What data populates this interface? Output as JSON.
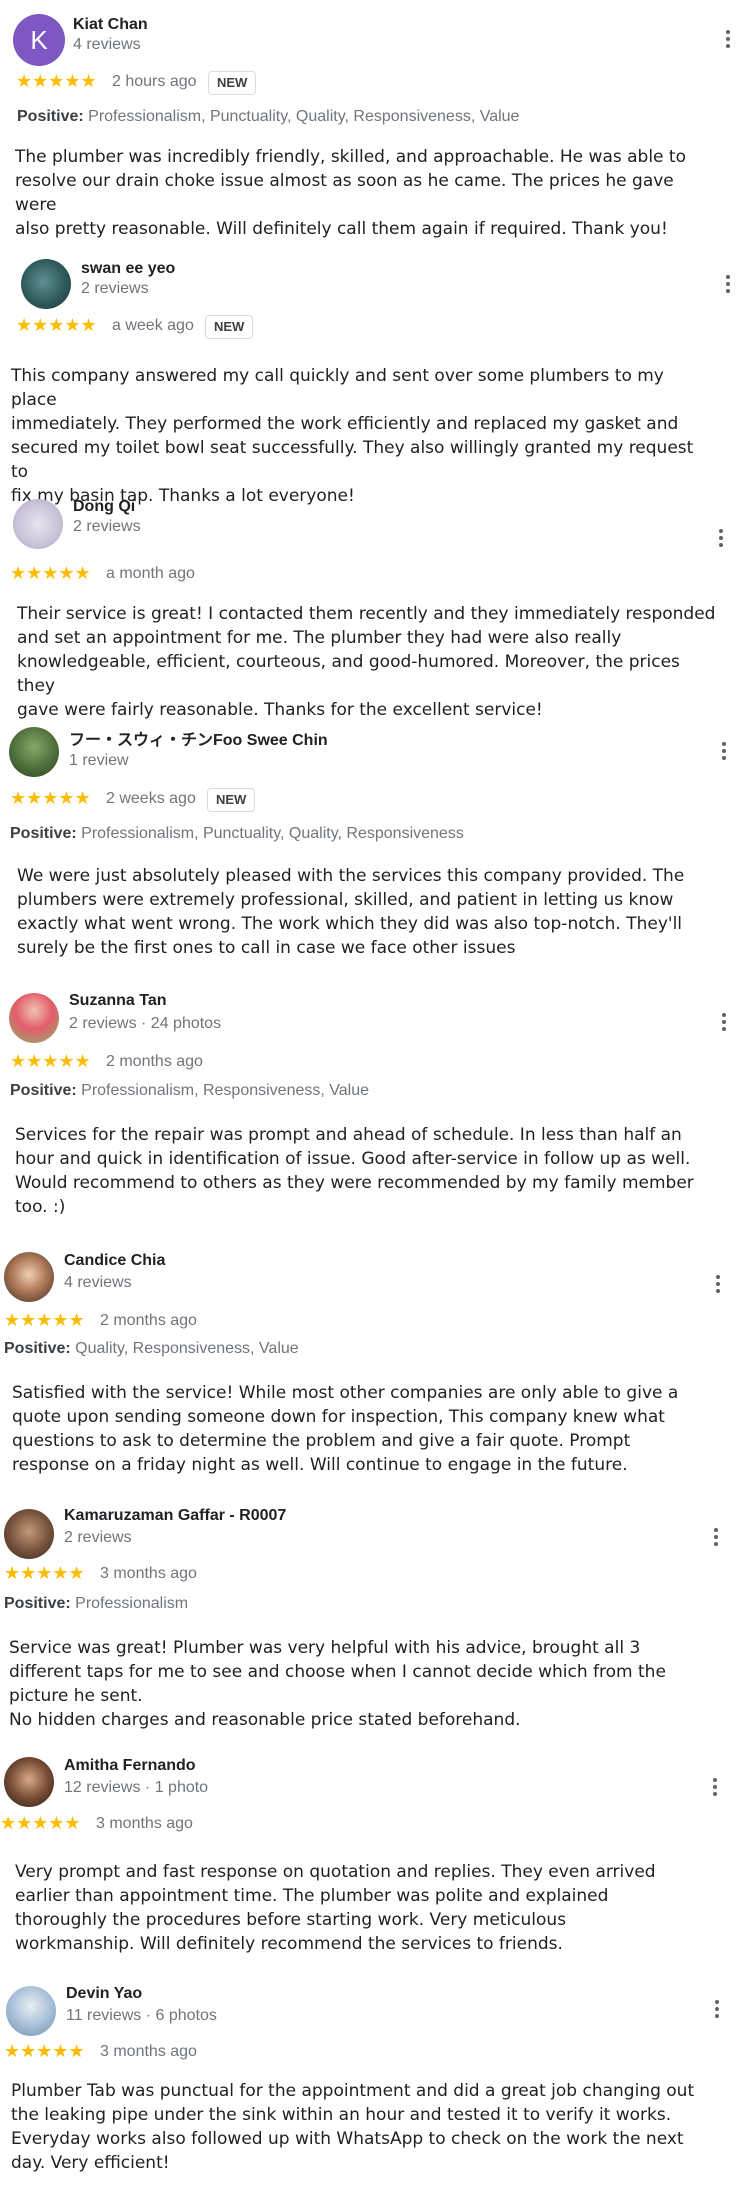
{
  "reviews": [
    {
      "name": "Kiat Chan",
      "meta": "4 reviews",
      "avatar_letter": "K",
      "stars": "★★★★★",
      "time": "2 hours ago",
      "badge": "NEW",
      "positive_label": "Positive:",
      "positive": "Professionalism, Punctuality, Quality, Responsiveness, Value",
      "text": "The plumber was incredibly friendly, skilled, and approachable. He was able to\nresolve our drain choke issue almost as soon as he came. The prices he gave were\nalso pretty reasonable. Will definitely call them again if required. Thank you!"
    },
    {
      "name": "swan ee yeo",
      "meta": "2 reviews",
      "stars": "★★★★★",
      "time": "a week ago",
      "badge": "NEW",
      "text": "This company answered my call quickly and sent over some plumbers to my place\nimmediately. They performed the work efficiently and replaced my gasket and\nsecured my toilet bowl seat successfully. They also willingly granted my request to\nfix my basin tap. Thanks a lot everyone!"
    },
    {
      "name": "Dong Qi",
      "meta": "2 reviews",
      "stars": "★★★★★",
      "time": "a month ago",
      "text": "Their service is great! I contacted them recently and they immediately responded\nand set an appointment for me. The plumber they had were also really\nknowledgeable, efficient, courteous, and good-humored. Moreover, the prices they\ngave were fairly reasonable. Thanks for the excellent service!"
    },
    {
      "name": "フー・スウィ・チンFoo Swee Chin",
      "meta": "1 review",
      "stars": "★★★★★",
      "time": "2 weeks ago",
      "badge": "NEW",
      "positive_label": "Positive:",
      "positive": "Professionalism, Punctuality, Quality, Responsiveness",
      "text": "We were just absolutely pleased with the services this company provided. The\nplumbers were extremely professional, skilled, and patient in letting us know\nexactly what went wrong. The work which they did was also top-notch. They'll\nsurely be the first ones to call in case we face other issues"
    },
    {
      "name": "Suzanna Tan",
      "meta": "2 reviews · 24 photos",
      "stars": "★★★★★",
      "time": "2 months ago",
      "positive_label": "Positive:",
      "positive": "Professionalism, Responsiveness, Value",
      "text": "Services for the repair was prompt and ahead of schedule. In less than half an\nhour and quick in identification of issue. Good after-service in follow up as well.\nWould recommend to others as they were recommended by my family member\ntoo. :)"
    },
    {
      "name": "Candice Chia",
      "meta": "4 reviews",
      "stars": "★★★★★",
      "time": "2 months ago",
      "positive_label": "Positive:",
      "positive": "Quality, Responsiveness, Value",
      "text": "Satisfied with the service! While most other companies are only able to give a\nquote upon sending someone down for inspection, This company knew what\nquestions to ask to determine the problem and give a fair quote. Prompt\nresponse on a friday night as well. Will continue to engage in the future."
    },
    {
      "name": "Kamaruzaman Gaffar - R0007",
      "meta": "2 reviews",
      "stars": "★★★★★",
      "time": "3 months ago",
      "positive_label": "Positive:",
      "positive": "Professionalism",
      "text": "Service was great! Plumber was very helpful with his advice, brought all 3\ndifferent taps for me to see and choose when I cannot decide which from the\npicture he sent.\nNo hidden charges and reasonable price stated beforehand."
    },
    {
      "name": "Amitha Fernando",
      "meta": "12 reviews · 1 photo",
      "stars": "★★★★★",
      "time": "3 months ago",
      "text": "Very prompt and fast response on quotation and replies. They even arrived\nearlier than appointment time. The plumber was polite and explained\nthoroughly the procedures before starting work. Very meticulous\nworkmanship. Will definitely recommend the services to friends."
    },
    {
      "name": "Devin Yao",
      "meta": "11 reviews · 6 photos",
      "stars": "★★★★★",
      "time": "3 months ago",
      "text": "Plumber Tab was punctual for the appointment and did a great job changing out\nthe leaking pipe under the sink within an hour and tested it to verify it works.\nEveryday works also followed up with WhatsApp to check on the work the next\nday. Very efficient!"
    }
  ]
}
